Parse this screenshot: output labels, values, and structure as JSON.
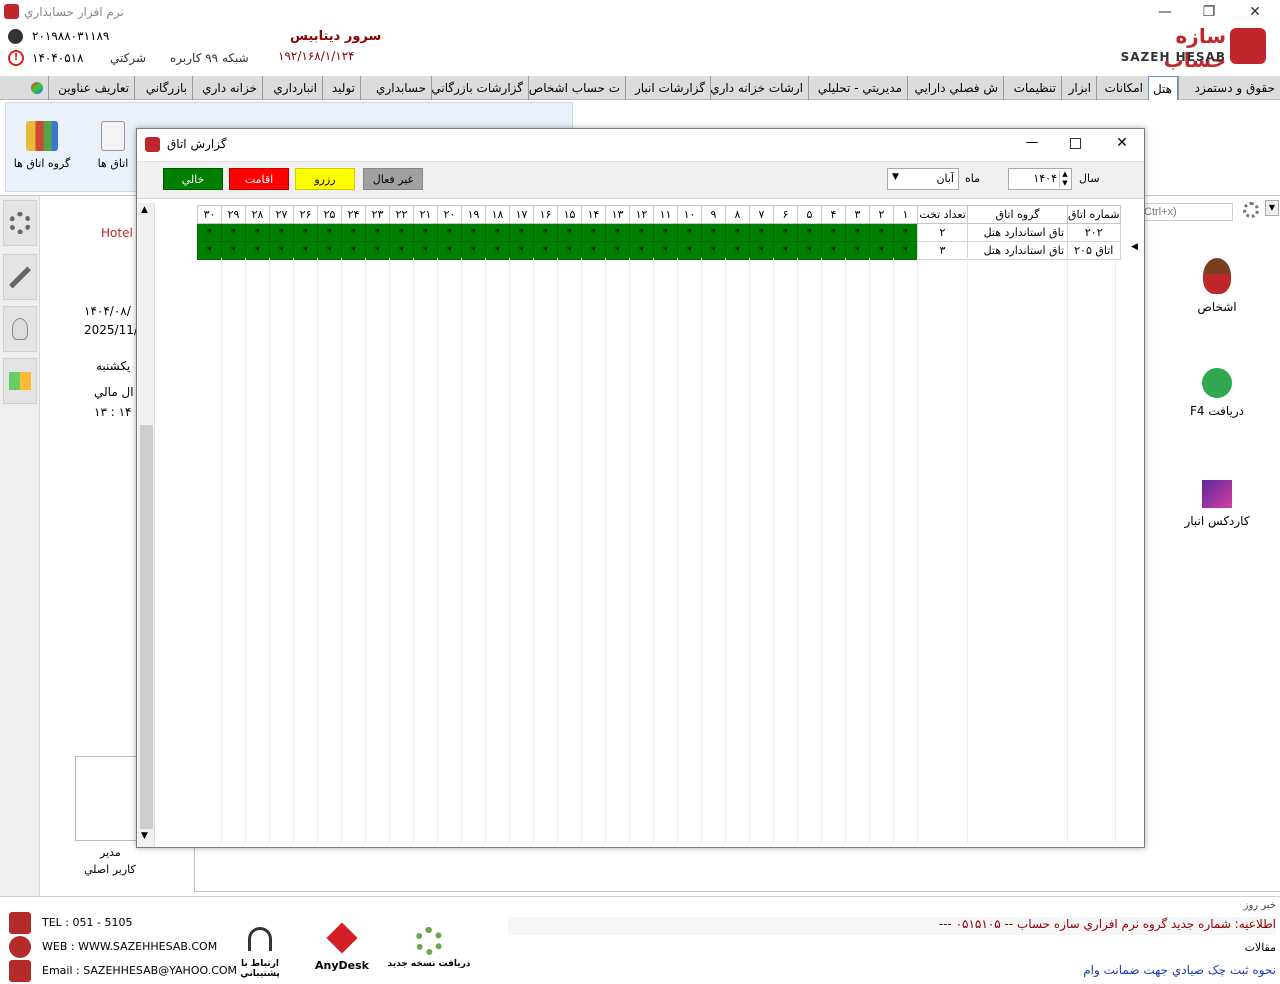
{
  "window": {
    "title": "نرم افزار حسابداري",
    "minimize": "—",
    "restore": "❐",
    "close": "✕"
  },
  "header": {
    "phone_number": "۲۰۱۹۸۸۰۳۱۱۸۹",
    "date_code": "۱۴۰۴۰۵۱۸",
    "company_type": "شركتي",
    "network_users": "شبکه ۹۹ کاربره",
    "server_label": "سرور ديتابيس",
    "server_ip": "۱۹۲/۱۶۸/۱/۱۲۴",
    "logo_fa": "سازه حساب",
    "logo_en": "SAZEH HESAB"
  },
  "menu_tabs": [
    "حقوق و دستمزد",
    "هتل",
    "امکانات",
    "ابزار",
    "تنظيمات",
    "ش فصلي دارايي",
    "مديريتي - تحليلي",
    "ارشات خزانه داري",
    "گزارشات انبار",
    "ت حساب اشخاص",
    "گزارشات بازرگاني",
    "حسابداري",
    "توليد",
    "انبارداري",
    "خزانه داري",
    "بازرگاني",
    "تعاريف عناوين"
  ],
  "ribbon": {
    "room_groups": "گروه اتاق ها",
    "rooms": "اتاق ها"
  },
  "left_info": {
    "hotel": "Hotel",
    "date_fa": "۱۴۰۴/۰۸/",
    "date_en": "2025/11/",
    "weekday": "يكشنبه",
    "fiscal_year": "ال مالي",
    "time": "۱۳ : ۱۴",
    "user_role": "مدير",
    "user_name": "كاربر اصلي"
  },
  "search": {
    "placeholder": "Ctrl+x)"
  },
  "shortcuts": {
    "persons": "اشخاص",
    "receipt": "F4   دريافت",
    "cardex": "كاردكس انبار"
  },
  "dialog": {
    "title": "گزارش اتاق",
    "year_label": "سال",
    "year_value": "۱۴۰۴",
    "month_label": "ماه",
    "month_value": "آبان",
    "legend": {
      "inactive": "غير فعال",
      "reserved": "رزرو",
      "stay": "اقامت",
      "empty": "خالي"
    }
  },
  "grid": {
    "headers": {
      "room_number": "شماره اتاق",
      "room_group": "گروه اتاق",
      "bed_count": "تعداد تخت"
    },
    "days": [
      "۱",
      "۲",
      "۳",
      "۴",
      "۵",
      "۶",
      "۷",
      "۸",
      "۹",
      "۱۰",
      "۱۱",
      "۱۲",
      "۱۳",
      "۱۴",
      "۱۵",
      "۱۶",
      "۱۷",
      "۱۸",
      "۱۹",
      "۲۰",
      "۲۱",
      "۲۲",
      "۲۳",
      "۲۴",
      "۲۵",
      "۲۶",
      "۲۷",
      "۲۸",
      "۲۹",
      "۳۰"
    ],
    "cell_mark": "*",
    "rows": [
      {
        "room_number": "۲۰۲",
        "room_group": "تاق استاندارد هتل",
        "bed_count": "۲"
      },
      {
        "room_number": "اتاق ۲۰۵",
        "room_group": "تاق استاندارد هتل",
        "bed_count": "۳"
      }
    ]
  },
  "footer": {
    "tel": "TEL : 051 - 5105",
    "web": "WEB : WWW.SAZEHHESAB.COM",
    "email": "Email : SAZEHHESAB@YAHOO.COM",
    "support": "ارتباط با پشتيباني",
    "anydesk": "AnyDesk",
    "update": "دريافت نسخه جديد",
    "news_title": "خبر روز",
    "news_text": "اطلاعيه: شماره جديد گروه نرم افزاري سازه حساب -- ۰۵۱۵۱۰۵ ---",
    "articles_title": "مقالات",
    "article_text": "نحوه ثبت چک صيادي جهت ضمانت وام"
  },
  "colors": {
    "empty": "#008000",
    "stay": "#ff0000",
    "reserved": "#ffff00",
    "inactive": "#a0a0a0",
    "accent": "#c0272d"
  }
}
